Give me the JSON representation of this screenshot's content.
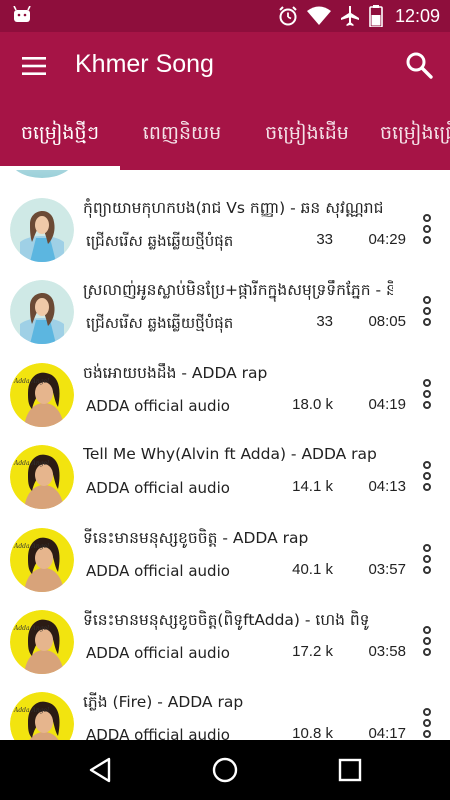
{
  "status_bar": {
    "time": "12:09",
    "icons": [
      "android-icon",
      "alarm-icon",
      "wifi-icon",
      "airplane-icon",
      "battery-icon"
    ]
  },
  "app_bar": {
    "title": "Khmer Song",
    "icons": [
      "menu-icon",
      "search-icon"
    ]
  },
  "tabs": [
    {
      "label": "ចម្រៀងថ្មីៗ",
      "selected": true
    },
    {
      "label": "ពេញនិយម",
      "selected": false
    },
    {
      "label": "ចម្រៀងដើម",
      "selected": false
    },
    {
      "label": "ចម្រៀងជ្រើសរើស",
      "selected": false
    }
  ],
  "songs": [
    {
      "title": "កុំព្យាយាមកុហកបង(រាជ Vs កញ្ញា) - ឆន សុវណ្ណរាជ",
      "subtitle": "ជ្រើសរើស ឆ្លងឆ្លើយថ្មីបំផុត",
      "views": "33",
      "duration": "04:29",
      "thumb": "girl-blue-dress"
    },
    {
      "title": "ស្រលាញ់អូនស្លាប់មិនប្រែ+ផ្ការីកក្នុងសមុទ្រទឹកភ្នែក - នីកូ",
      "subtitle": "ជ្រើសរើស ឆ្លងឆ្លើយថ្មីបំផុត",
      "views": "33",
      "duration": "08:05",
      "thumb": "girl-blue-dress"
    },
    {
      "title": "ចង់អោយបងដឹង - ADDA rap",
      "subtitle": "ADDA official audio",
      "views": "18.0 k",
      "duration": "04:19",
      "thumb": "adda-angel"
    },
    {
      "title": "Tell Me Why(Alvin ft Adda) - ADDA rap",
      "subtitle": "ADDA official audio",
      "views": "14.1 k",
      "duration": "04:13",
      "thumb": "adda-angel"
    },
    {
      "title": "ទីនេះមានមនុស្សខូចចិត្ត - ADDA rap",
      "subtitle": "ADDA official audio",
      "views": "40.1 k",
      "duration": "03:57",
      "thumb": "adda-angel"
    },
    {
      "title": "ទីនេះមានមនុស្សខូចចិត្ត(ពិទូftAdda) - ហេង ពិទូ",
      "subtitle": "ADDA official audio",
      "views": "17.2 k",
      "duration": "03:58",
      "thumb": "adda-angel"
    },
    {
      "title": "ភ្លើង (Fire) - ADDA rap",
      "subtitle": "ADDA official audio",
      "views": "10.8 k",
      "duration": "04:17",
      "thumb": "adda-angel"
    }
  ],
  "thumb_label": "Adda Angel",
  "colors": {
    "status_bar": "#8e0e3c",
    "app_bar": "#a61446",
    "nav_bar": "#000000"
  },
  "nav": [
    "back-icon",
    "home-icon",
    "recents-icon"
  ]
}
